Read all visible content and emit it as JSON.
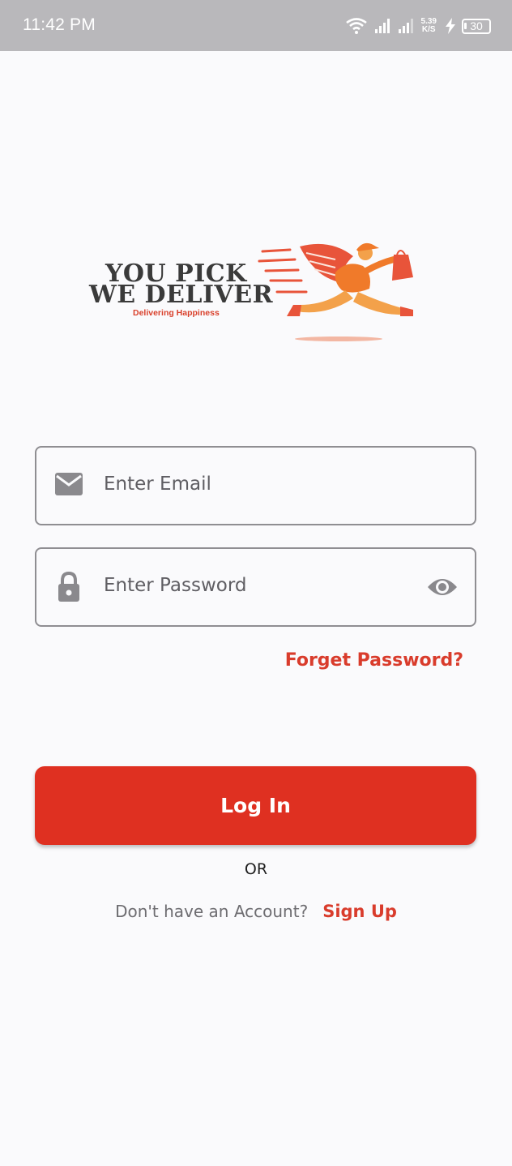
{
  "status_bar": {
    "time": "11:42 PM",
    "network_speed_value": "5.39",
    "network_speed_unit": "K/S",
    "battery": "30",
    "icons": [
      "wifi-icon",
      "signal-icon",
      "signal-icon",
      "charging-icon",
      "battery-icon"
    ]
  },
  "logo": {
    "line1": "YOU PICK",
    "line2": "WE DELIVER",
    "tagline": "Delivering Happiness"
  },
  "form": {
    "email_placeholder": "Enter Email",
    "password_placeholder": "Enter Password",
    "forgot_password": "Forget Password?",
    "login_button": "Log In",
    "or_text": "OR",
    "signup_prompt": "Don't have an Account?",
    "signup_link": "Sign Up"
  },
  "colors": {
    "accent": "#df3021",
    "link": "#d93c2c",
    "status_bar": "#b9b8bb",
    "background": "#fafafc",
    "field_border": "#8f8e92"
  }
}
